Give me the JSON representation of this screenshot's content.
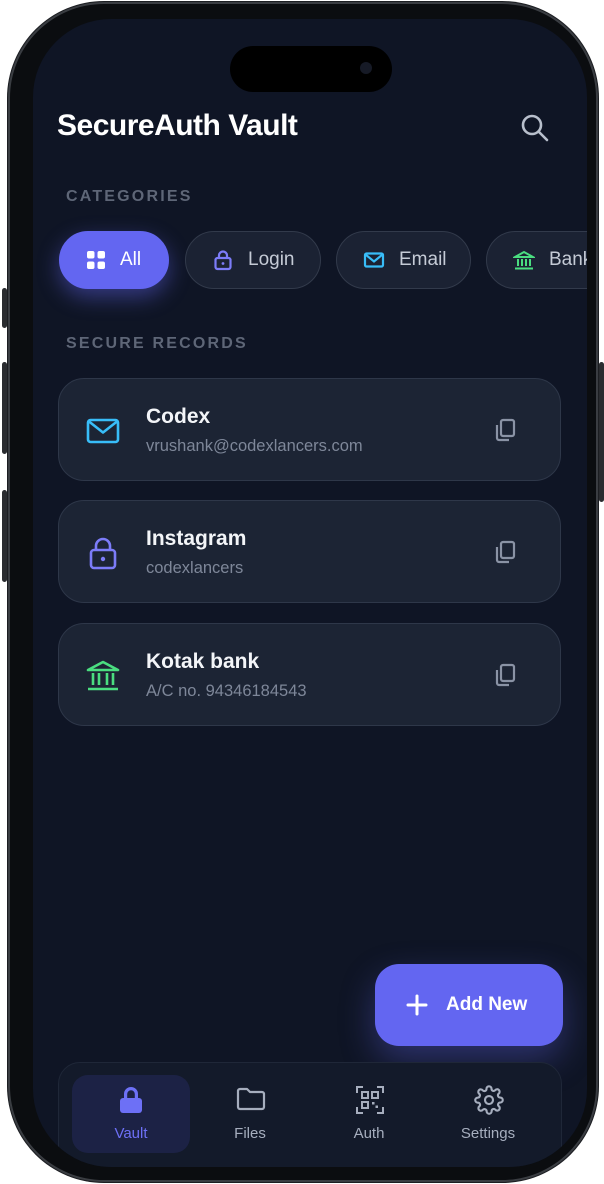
{
  "header": {
    "title": "SecureAuth Vault",
    "search_icon": "search-icon"
  },
  "categories": {
    "label": "CATEGORIES",
    "items": [
      {
        "label": "All",
        "icon": "grid-icon",
        "active": true
      },
      {
        "label": "Login",
        "icon": "lock-icon",
        "active": false
      },
      {
        "label": "Email",
        "icon": "mail-icon",
        "active": false
      },
      {
        "label": "Bank",
        "icon": "bank-icon",
        "active": false
      }
    ]
  },
  "records": {
    "label": "SECURE RECORDS",
    "items": [
      {
        "name": "Codex",
        "detail": "vrushank@codexlancers.com",
        "icon": "mail-icon",
        "color": "#38bdf8"
      },
      {
        "name": "Instagram",
        "detail": "codexlancers",
        "icon": "lock-icon",
        "color": "#7c7cf8"
      },
      {
        "name": "Kotak bank",
        "detail": "A/C no. 94346184543",
        "icon": "bank-icon",
        "color": "#4ade80"
      }
    ]
  },
  "fab": {
    "label": "Add New",
    "icon": "plus-icon"
  },
  "bottom_nav": {
    "items": [
      {
        "label": "Vault",
        "icon": "lock-icon",
        "active": true
      },
      {
        "label": "Files",
        "icon": "folder-icon",
        "active": false
      },
      {
        "label": "Auth",
        "icon": "qr-code-icon",
        "active": false
      },
      {
        "label": "Settings",
        "icon": "gear-icon",
        "active": false
      }
    ]
  },
  "colors": {
    "accent": "#6366f1",
    "background": "#0f1525",
    "card": "#1c2434",
    "mail": "#38bdf8",
    "lock": "#7c7cf8",
    "bank": "#4ade80"
  }
}
